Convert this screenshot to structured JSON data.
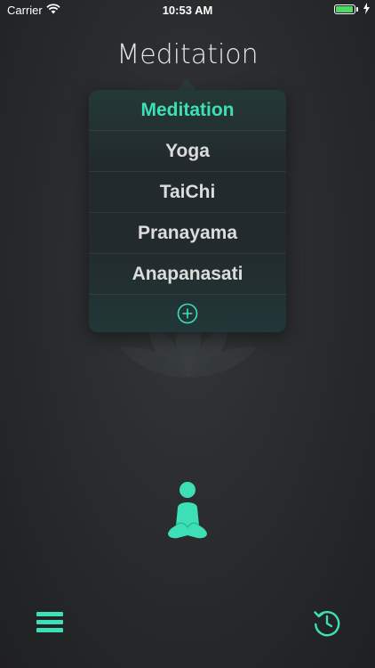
{
  "status": {
    "carrier": "Carrier",
    "time": "10:53 AM",
    "battery_level": 0.95
  },
  "header": {
    "title": "Meditation"
  },
  "picker": {
    "options": [
      "Meditation",
      "Yoga",
      "TaiChi",
      "Pranayama",
      "Anapanasati"
    ],
    "selected": "Meditation"
  },
  "colors": {
    "accent": "#3de0b6",
    "background": "#2a2c2e",
    "popover": "#232a2d"
  },
  "icons": {
    "add": "plus-circle-icon",
    "figure": "meditation-figure-icon",
    "menu": "hamburger-menu-icon",
    "history": "clock-history-icon"
  }
}
